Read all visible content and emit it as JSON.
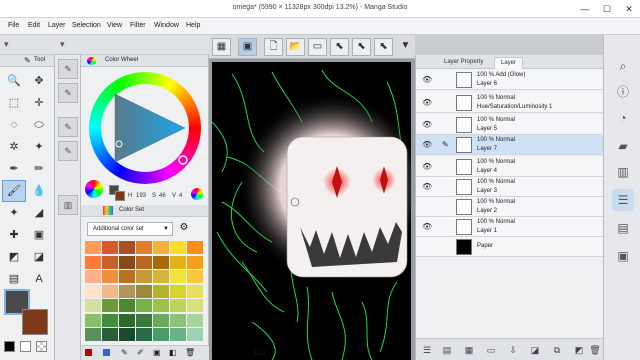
{
  "window": {
    "title": "omega* (5990 × 11328px 300dpi 13.2%) - Manga Studio",
    "minimize": "—",
    "maximize": "☐",
    "close": "✕"
  },
  "menu": [
    "File",
    "Edit",
    "Layer",
    "Selection",
    "View",
    "Filter",
    "Window",
    "Help"
  ],
  "tool_panel": {
    "label": "Tool"
  },
  "color_wheel": {
    "label": "Color Wheel",
    "h": "193",
    "s": "46",
    "v": "4",
    "main_color": "#4a4a4a",
    "sub_color": "#7d3a1a"
  },
  "color_set": {
    "label": "Color Set",
    "selected_set": "Additional color set"
  },
  "canvas": {
    "zoom": "13.2"
  },
  "layers": {
    "tab_property": "Layer Property",
    "tab_layer": "Layer",
    "rows": [
      {
        "line1": "100 %  Add (Glow)",
        "line2": "Layer 6"
      },
      {
        "line1": "100 %  Normal",
        "line2": "Hue/Saturation/Luminosity 1"
      },
      {
        "line1": "100 %  Normal",
        "line2": "Layer 5"
      },
      {
        "line1": "100 %  Normal",
        "line2": "Layer 7"
      },
      {
        "line1": "100 %  Normal",
        "line2": "Layer 4"
      },
      {
        "line1": "100 %  Normal",
        "line2": "Layer 3"
      },
      {
        "line1": "100 %  Normal",
        "line2": "Layer 2"
      },
      {
        "line1": "100 %  Normal",
        "line2": "Layer 1"
      },
      {
        "line1": "",
        "line2": "Paper"
      }
    ]
  },
  "colors": {
    "accent": "#6c9ccd",
    "canvas_bg": "#000000",
    "line_green": "#1fd64a",
    "eye_red": "#e02020"
  }
}
